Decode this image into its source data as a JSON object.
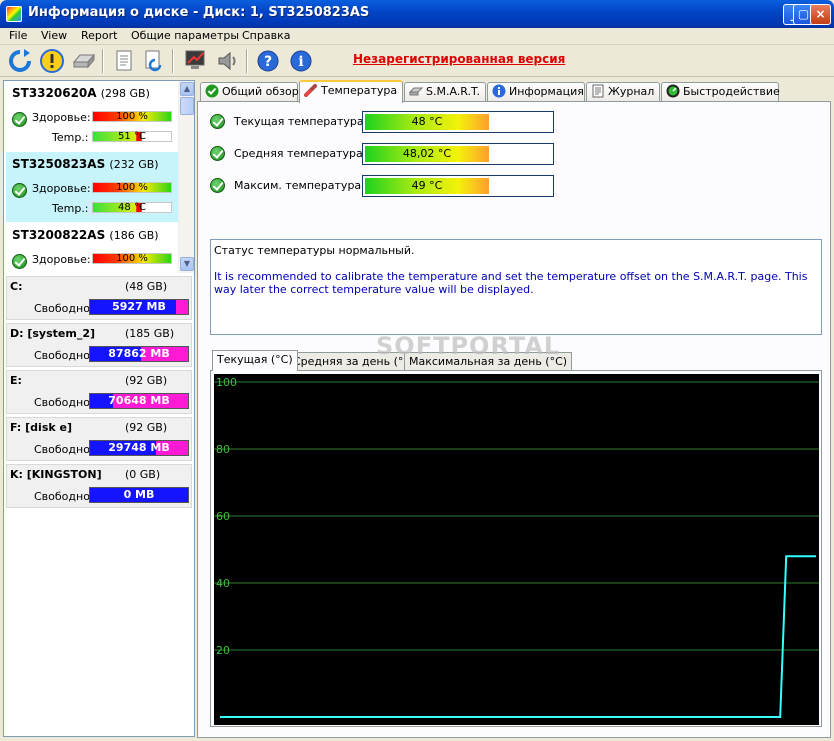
{
  "window": {
    "title": "Информация о диске - Диск: 1, ST3250823AS"
  },
  "menu": [
    "File",
    "View",
    "Report",
    "Общие параметры",
    "Справка"
  ],
  "toolbar": {
    "unregistered": "Незарегистрированная версия"
  },
  "disks": [
    {
      "name": "ST3320620A",
      "size": "(298 GB)",
      "health_label": "Здоровье:",
      "health": "100 %",
      "temp_label": "Temp.:",
      "temp": "51 °C"
    },
    {
      "name": "ST3250823AS",
      "size": "(232 GB)",
      "health_label": "Здоровье:",
      "health": "100 %",
      "temp_label": "Temp.:",
      "temp": "48 °C"
    },
    {
      "name": "ST3200822AS",
      "size": "(186 GB)",
      "health_label": "Здоровье:",
      "health": "100 %"
    }
  ],
  "partitions": [
    {
      "name": "C:",
      "size": "(48 GB)",
      "free_label": "Свободно",
      "free": "5927 MB"
    },
    {
      "name": "D: [system_2]",
      "size": "(185 GB)",
      "free_label": "Свободно",
      "free": "87862 MB"
    },
    {
      "name": "E:",
      "size": "(92 GB)",
      "free_label": "Свободно",
      "free": "70648 MB"
    },
    {
      "name": "F: [disk e]",
      "size": "(92 GB)",
      "free_label": "Свободно",
      "free": "29748 MB"
    },
    {
      "name": "K: [KINGSTON]",
      "size": "(0 GB)",
      "free_label": "Свободно",
      "free": "0 MB"
    }
  ],
  "tabs": [
    "Общий обзор",
    "Температура",
    "S.M.A.R.T.",
    "Информация",
    "Журнал",
    "Быстродействие"
  ],
  "temps": [
    {
      "label": "Текущая температура:",
      "value": "48 °C"
    },
    {
      "label": "Средняя температура:",
      "value": "48,02 °C"
    },
    {
      "label": "Максим. температура:",
      "value": "49 °C"
    }
  ],
  "status": {
    "line1": "Статус температуры нормальный.",
    "line2": "It is recommended to calibrate the temperature and set the temperature offset on the S.M.A.R.T. page. This way later the correct temperature value will be displayed."
  },
  "subtabs": [
    "Текущая (°C)",
    "Средняя за день (°C)",
    "Максимальная за день (°C)"
  ],
  "watermark": "SOFTPORTAL",
  "chart_data": {
    "type": "line",
    "ylim": [
      0,
      100
    ],
    "yticks": [
      "100",
      "80",
      "60",
      "40",
      "20"
    ],
    "series": [
      {
        "values": [
          0,
          0,
          0,
          0,
          0,
          0,
          0,
          0,
          0,
          0,
          0,
          0,
          0,
          0,
          0,
          0,
          0,
          0,
          0,
          0,
          0,
          0,
          0,
          0,
          0,
          0,
          0,
          0,
          0,
          0,
          0,
          0,
          0,
          0,
          0,
          0,
          0,
          0,
          0,
          0,
          0,
          0,
          0,
          0,
          0,
          0,
          0,
          0,
          0,
          0,
          0,
          0,
          0,
          0,
          0,
          0,
          0,
          0,
          0,
          0,
          0,
          0,
          0,
          0,
          0,
          0,
          0,
          0,
          0,
          0,
          0,
          0,
          0,
          0,
          0,
          0,
          0,
          0,
          0,
          0,
          0,
          0,
          0,
          0,
          0,
          0,
          0,
          0,
          0,
          0,
          0,
          0,
          0,
          0,
          0,
          48,
          48,
          48,
          48,
          48,
          48
        ]
      }
    ],
    "line_color": "#33ffff",
    "grid_color": "#2e7d2e",
    "tick_color": "#3fbf3f",
    "background": "#000000"
  }
}
